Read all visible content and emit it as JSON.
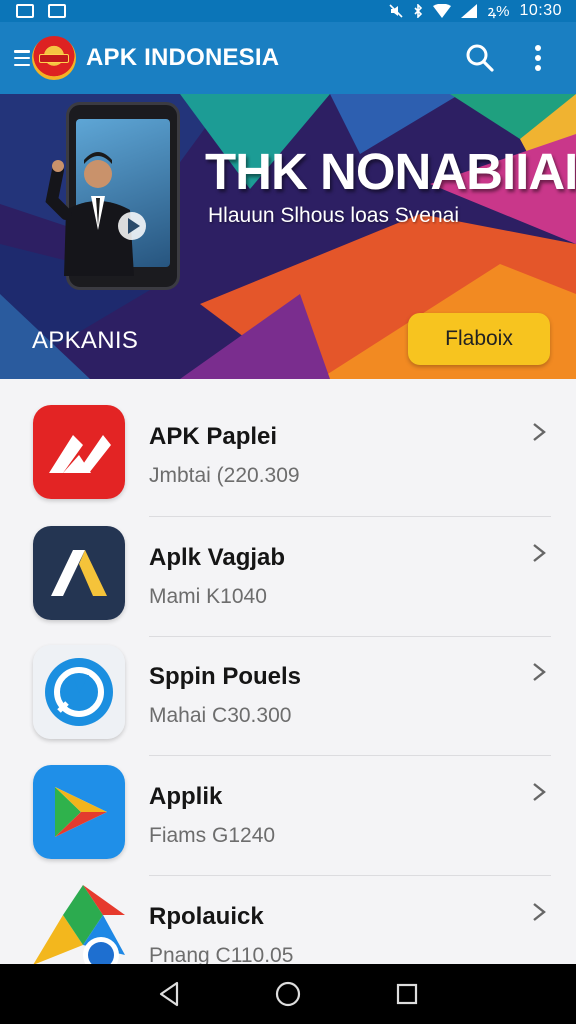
{
  "status_bar": {
    "time": "10:30",
    "battery_text": "ꝝ%",
    "left_icons": [
      "mail-icon",
      "image-icon"
    ],
    "right_icons": [
      "mute-icon",
      "bluetooth-icon",
      "wifi-icon",
      "signal-icon"
    ]
  },
  "app_bar": {
    "title": "APK INDONESIA",
    "icons": [
      "menu-icon",
      "app-logo",
      "search-icon",
      "more-vert-icon"
    ]
  },
  "banner": {
    "title": "THK NONABIIAI",
    "subtitle": "Hlauun Slhous loas Svenai",
    "brand": "APKANIS",
    "button_label": "Flaboix"
  },
  "apps": [
    {
      "name": "APK Paplei",
      "meta": "Jmbtai (220.309",
      "icon": "red-app-icon"
    },
    {
      "name": "Aplk Vagjab",
      "meta": "Mami K1040",
      "icon": "navy-a-app-icon"
    },
    {
      "name": "Sppin Pouels",
      "meta": "Mahai C30.300",
      "icon": "blue-circle-app-icon"
    },
    {
      "name": "Applik",
      "meta": "Fiams G1240",
      "icon": "play-triangle-app-icon"
    },
    {
      "name": "Rpolauick",
      "meta": "Pnang C110.05",
      "icon": "multicolor-app-icon"
    }
  ],
  "colors": {
    "app_bar": "#1a7fc2",
    "status_bar": "#0b75b8",
    "button": "#f7c41f",
    "nav_bar": "#000000"
  },
  "nav_bar": {
    "icons": [
      "back-icon",
      "home-icon",
      "recents-icon"
    ]
  }
}
